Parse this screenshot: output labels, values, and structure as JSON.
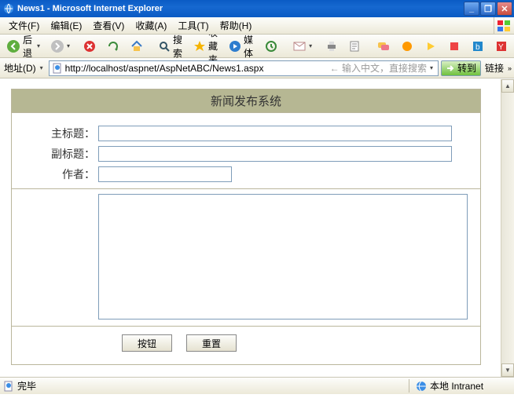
{
  "window": {
    "title": "News1 - Microsoft Internet Explorer"
  },
  "menu": {
    "file": "文件(F)",
    "edit": "编辑(E)",
    "view": "查看(V)",
    "fav": "收藏(A)",
    "tools": "工具(T)",
    "help": "帮助(H)"
  },
  "tb": {
    "back": "后退",
    "search": "搜索",
    "favorites": "收藏夹",
    "media": "媒体"
  },
  "addr": {
    "label": "地址(D)",
    "url": "http://localhost/aspnet/AspNetABC/News1.aspx",
    "hint": "输入中文，直接搜索",
    "go": "转到",
    "links": "链接"
  },
  "form": {
    "title": "新闻发布系统",
    "main_label": "主标题：",
    "sub_label": "副标题：",
    "author_label": "作者：",
    "main_value": "",
    "sub_value": "",
    "author_value": "",
    "body_value": "",
    "submit": "按钮",
    "reset": "重置"
  },
  "status": {
    "done": "完毕",
    "zone": "本地 Intranet"
  }
}
